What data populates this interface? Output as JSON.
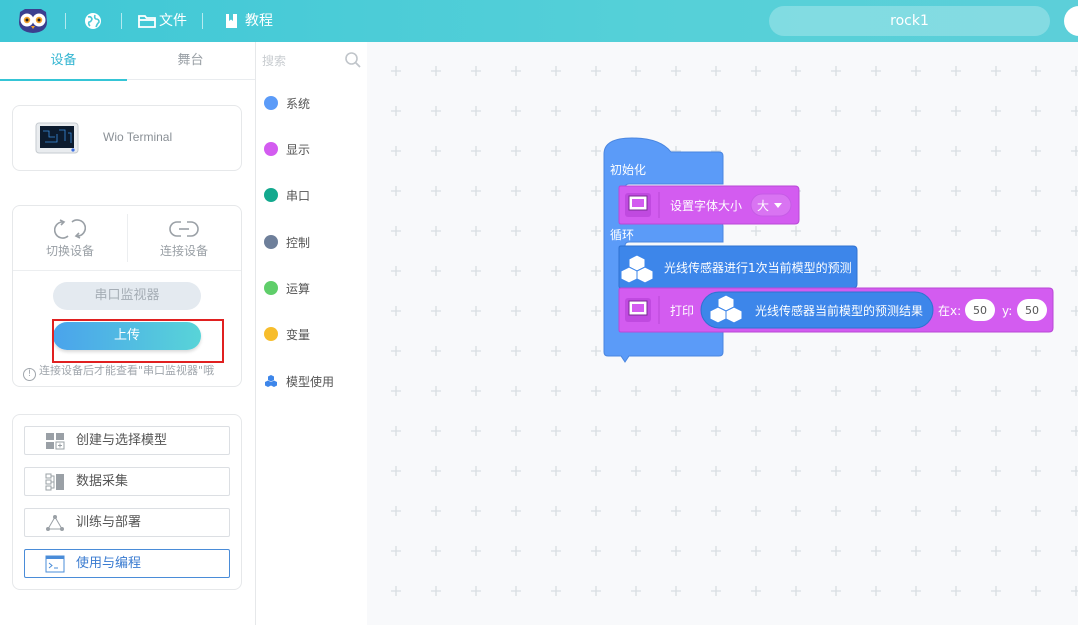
{
  "topbar": {
    "logo_icon": "owl-logo-icon",
    "globe_icon": "globe-icon",
    "file_icon": "folder-icon",
    "file_label": "文件",
    "tutorial_icon": "book-icon",
    "tutorial_label": "教程",
    "project_name": "rock1"
  },
  "left_panel": {
    "tabs": [
      {
        "label": "设备",
        "active": true
      },
      {
        "label": "舞台",
        "active": false
      }
    ],
    "device": {
      "name": "Wio Terminal"
    },
    "connection": {
      "switch_label": "切换设备",
      "connect_label": "连接设备",
      "monitor_label": "串口监视器",
      "upload_label": "上传",
      "hint": "连接设备后才能查看\"串口监视器\"哦"
    },
    "workflow": [
      {
        "label": "创建与选择模型",
        "icon": "model-grid-icon",
        "active": false
      },
      {
        "label": "数据采集",
        "icon": "data-collect-icon",
        "active": false
      },
      {
        "label": "训练与部署",
        "icon": "train-deploy-icon",
        "active": false
      },
      {
        "label": "使用与编程",
        "icon": "terminal-icon",
        "active": true
      }
    ]
  },
  "categories": {
    "search_placeholder": "搜索",
    "items": [
      {
        "label": "系统",
        "color": "#5b9bf8"
      },
      {
        "label": "显示",
        "color": "#d35cf0"
      },
      {
        "label": "串口",
        "color": "#13a98e"
      },
      {
        "label": "控制",
        "color": "#6e7f9a"
      },
      {
        "label": "运算",
        "color": "#5fce6a"
      },
      {
        "label": "变量",
        "color": "#f7bd2c"
      },
      {
        "label": "模型使用",
        "color": "#3d86ea"
      }
    ]
  },
  "blocks": {
    "init_label": "初始化",
    "set_font_label": "设置字体大小",
    "font_size_value": "大",
    "loop_label": "循环",
    "predict_label": "光线传感器进行1次当前模型的预测",
    "print_label": "打印",
    "result_label": "光线传感器当前模型的预测结果",
    "at_x_label": "在x:",
    "x_value": "50",
    "y_label": "y:",
    "y_value": "50",
    "colors": {
      "system": "#5b9bf8",
      "display": "#d35cf0",
      "model": "#3d86ea"
    }
  }
}
